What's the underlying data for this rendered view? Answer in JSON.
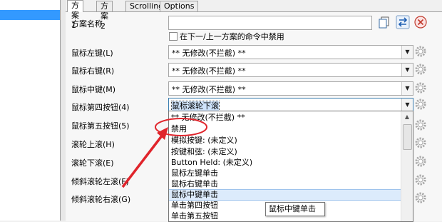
{
  "tabs": [
    "方案 1",
    "方案 2",
    "Scrolling",
    "Options"
  ],
  "form": {
    "scheme_name_label": "方案名称",
    "scheme_name_value": "",
    "disable_checkbox_label": "在下一/上一方案的命令中禁用",
    "disable_checked": false
  },
  "rows": [
    {
      "label": "鼠标左键(L)",
      "value": "** 无修改(不拦截) **"
    },
    {
      "label": "鼠标右键(R)",
      "value": "** 无修改(不拦截) **"
    },
    {
      "label": "鼠标中键(M)",
      "value": "** 无修改(不拦截) **"
    },
    {
      "label": "鼠标第四按钮(4)",
      "value": "鼠标滚轮下滚"
    },
    {
      "label": "鼠标第五按钮(5)"
    },
    {
      "label": "滚轮上滚(H)"
    },
    {
      "label": "滚轮下滚(E)"
    },
    {
      "label": "倾斜滚轮左滚(F)"
    },
    {
      "label": "倾斜滚轮右滚(G)"
    }
  ],
  "dropdown_options": [
    "** 无修改(不拦截) **",
    "禁用",
    "模拟按键: (未定义)",
    "按键和弦: (未定义)",
    "Button Held: (未定义)",
    "鼠标左键单击",
    "鼠标右键单击",
    "鼠标中键单击",
    "单击第四按钮",
    "单击第五按钮"
  ],
  "highlighted_option": "鼠标中键单击",
  "tooltip": "鼠标中键单击",
  "icons": [
    "copy-icon",
    "swap-icon",
    "delete-icon",
    "gear-icon",
    "chevron-down-icon"
  ],
  "colors": {
    "annotation_red": "#e0242b",
    "selection_blue": "#3399ff",
    "highlight_bg": "#dcebfc"
  }
}
